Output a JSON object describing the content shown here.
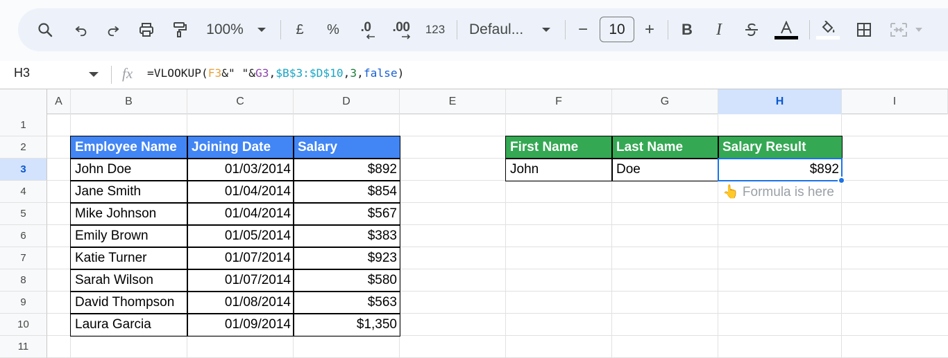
{
  "toolbar": {
    "zoom": "100%",
    "currency": "£",
    "percent": "%",
    "decrease_decimal": ".0",
    "increase_decimal": ".00",
    "number_format": "123",
    "font": "Defaul...",
    "font_size": "10",
    "minus": "−",
    "plus": "+",
    "bold": "B",
    "italic": "I"
  },
  "formula_bar": {
    "cell_ref": "H3",
    "fx": "fx",
    "formula_parts": {
      "p1": "=VLOOKUP(",
      "p2": "F3",
      "p3": "&\" \"&",
      "p4": "G3",
      "p5": ",",
      "p6": "$B$3:$D$10",
      "p7": ",",
      "p8": "3",
      "p9": ",",
      "p10": "false",
      "p11": ")"
    }
  },
  "columns": [
    "A",
    "B",
    "C",
    "D",
    "E",
    "F",
    "G",
    "H",
    "I"
  ],
  "rows": [
    "1",
    "2",
    "3",
    "4",
    "5",
    "6",
    "7",
    "8",
    "9",
    "10",
    "11"
  ],
  "employee_table": {
    "headers": [
      "Employee Name",
      "Joining Date",
      "Salary"
    ],
    "rows": [
      [
        "John Doe",
        "01/03/2014",
        "$892"
      ],
      [
        "Jane Smith",
        "01/04/2014",
        "$854"
      ],
      [
        "Mike Johnson",
        "01/04/2014",
        "$567"
      ],
      [
        "Emily Brown",
        "01/05/2014",
        "$383"
      ],
      [
        "Katie Turner",
        "01/07/2014",
        "$923"
      ],
      [
        "Sarah Wilson",
        "01/07/2014",
        "$580"
      ],
      [
        "David Thompson",
        "01/08/2014",
        "$563"
      ],
      [
        "Laura Garcia",
        "01/09/2014",
        "$1,350"
      ]
    ]
  },
  "lookup_table": {
    "headers": [
      "First Name",
      "Last Name",
      "Salary Result"
    ],
    "row": [
      "John",
      "Doe",
      "$892"
    ]
  },
  "note": "👆 Formula is here",
  "colors": {
    "employee_header": "#4285f4",
    "lookup_header": "#34a853",
    "selection": "#1a73e8"
  }
}
